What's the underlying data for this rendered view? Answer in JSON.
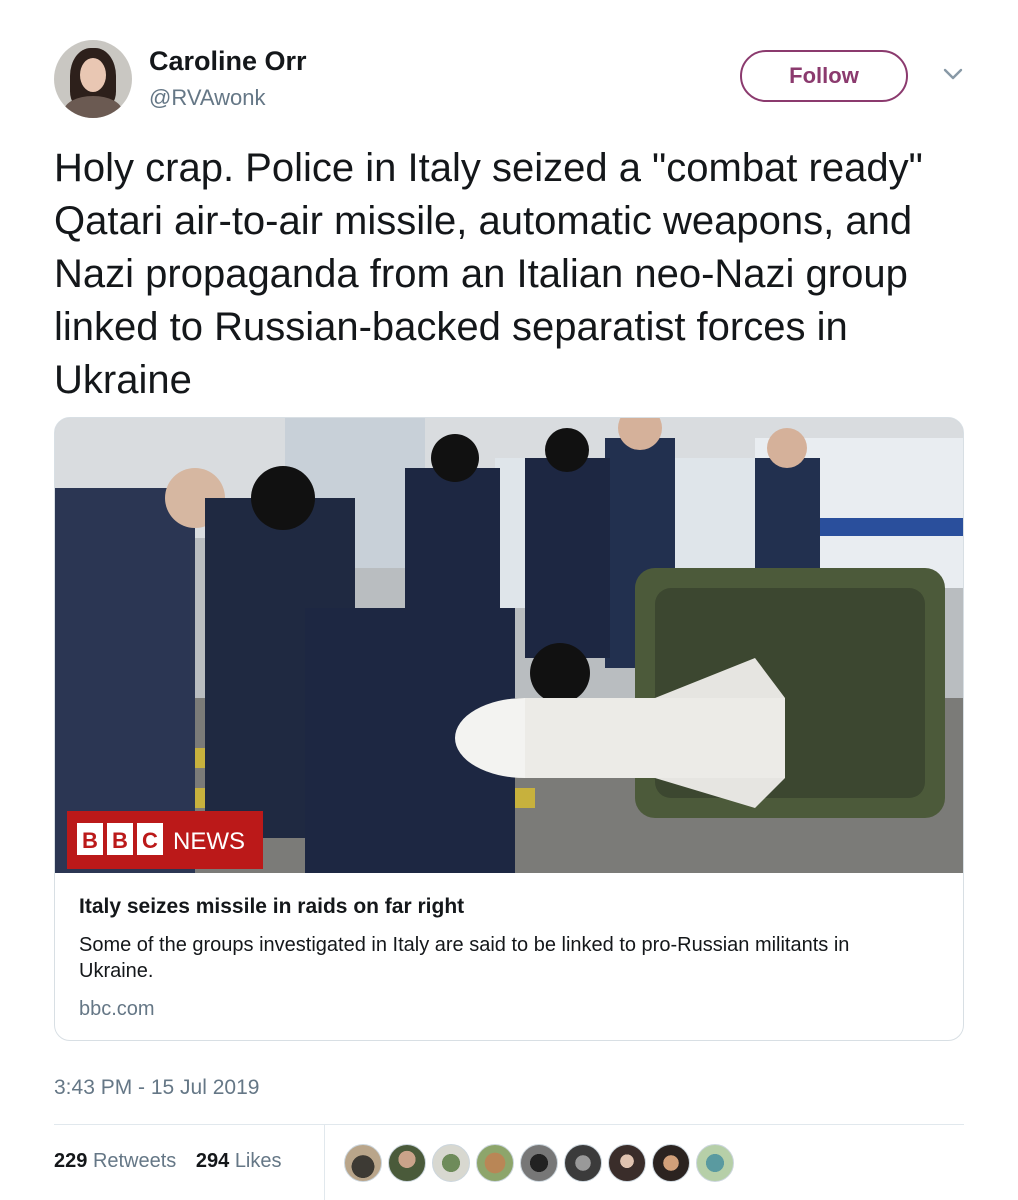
{
  "author": {
    "name": "Caroline Orr",
    "handle": "@RVAwonk",
    "avatar_icon": "profile-photo"
  },
  "actions": {
    "follow_label": "Follow",
    "menu_icon": "chevron-down-icon"
  },
  "tweet": {
    "text": "Holy crap. Police in Italy seized a \"combat ready\" Qatari air-to-air missile, automatic weapons, and Nazi propaganda from an Italian neo-Nazi group linked to Russian-backed separatist forces in Ukraine",
    "timestamp": "3:43 PM - 15 Jul 2019"
  },
  "card": {
    "image_brand": "BBC NEWS",
    "title": "Italy seizes missile in raids on far right",
    "description": "Some of the groups investigated in Italy are said to be linked to pro-Russian militants in Ukraine.",
    "domain": "bbc.com"
  },
  "stats": {
    "retweets_count": "229",
    "retweets_label": "Retweets",
    "likes_count": "294",
    "likes_label": "Likes"
  },
  "colors": {
    "accent": "#8b3a6e",
    "muted_text": "#657786",
    "bbc_red": "#bb1919"
  }
}
